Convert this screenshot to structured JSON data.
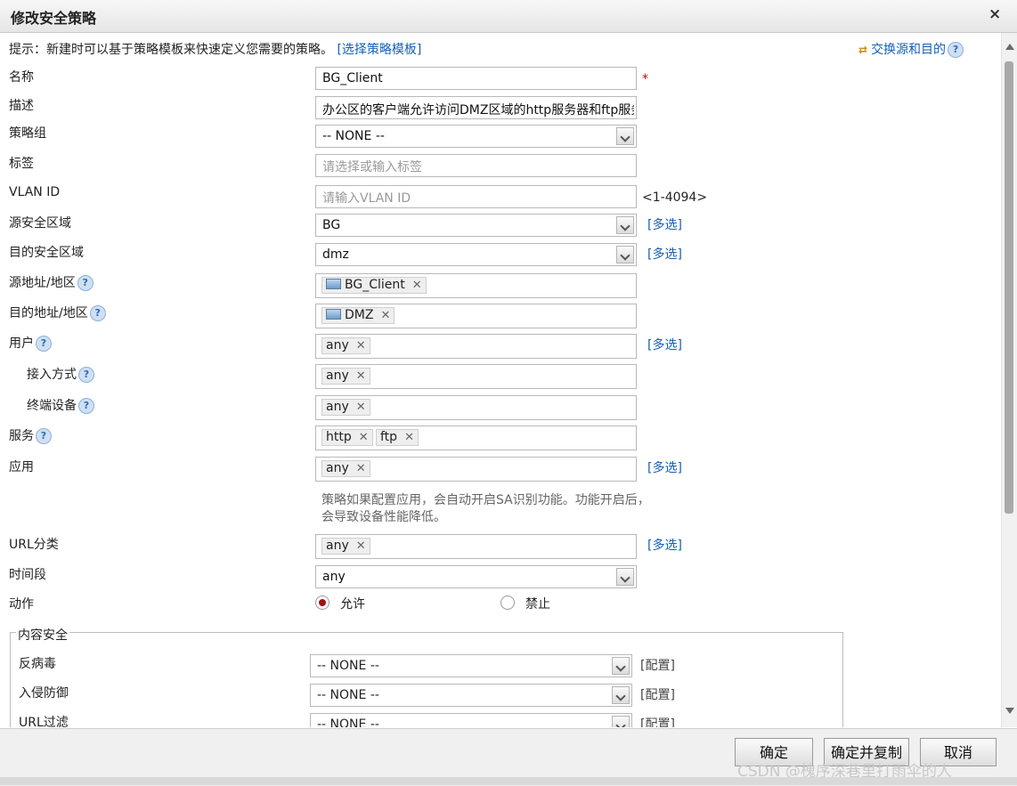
{
  "dialog": {
    "title": "修改安全策略",
    "close": "×"
  },
  "hint": {
    "text": "提示：新建时可以基于策略模板来快速定义您需要的策略。",
    "link": "[选择策略模板]"
  },
  "swap": {
    "icon": "swap-arrows-icon",
    "label": "交换源和目的"
  },
  "help_glyph": "?",
  "fields": {
    "name": {
      "label": "名称",
      "value": "BG_Client",
      "required": "*"
    },
    "desc": {
      "label": "描述",
      "value": "办公区的客户端允许访问DMZ区域的http服务器和ftp服务器"
    },
    "group": {
      "label": "策略组",
      "value": "-- NONE --"
    },
    "tag": {
      "label": "标签",
      "placeholder": "请选择或输入标签"
    },
    "vlan": {
      "label": "VLAN ID",
      "placeholder": "请输入VLAN ID",
      "range": "<1-4094>"
    },
    "src_zone": {
      "label": "源安全区域",
      "value": "BG",
      "multi": "[多选]"
    },
    "dst_zone": {
      "label": "目的安全区域",
      "value": "dmz",
      "multi": "[多选]"
    },
    "src_addr": {
      "label": "源地址/地区",
      "tags": [
        "BG_Client"
      ]
    },
    "dst_addr": {
      "label": "目的地址/地区",
      "tags": [
        "DMZ"
      ]
    },
    "user": {
      "label": "用户",
      "tags": [
        "any"
      ],
      "multi": "[多选]"
    },
    "access": {
      "label": "接入方式",
      "tags": [
        "any"
      ]
    },
    "terminal": {
      "label": "终端设备",
      "tags": [
        "any"
      ]
    },
    "service": {
      "label": "服务",
      "tags": [
        "http",
        "ftp"
      ]
    },
    "app": {
      "label": "应用",
      "tags": [
        "any"
      ],
      "multi": "[多选]",
      "note": "策略如果配置应用，会自动开启SA识别功能。功能开启后，会导致设备性能降低。"
    },
    "url": {
      "label": "URL分类",
      "tags": [
        "any"
      ],
      "multi": "[多选]"
    },
    "time": {
      "label": "时间段",
      "value": "any"
    },
    "action": {
      "label": "动作",
      "allow": "允许",
      "deny": "禁止",
      "selected": "允许"
    }
  },
  "content_security": {
    "legend": "内容安全",
    "rows": [
      {
        "label": "反病毒",
        "value": "-- NONE --",
        "config": "[配置]"
      },
      {
        "label": "入侵防御",
        "value": "-- NONE --",
        "config": "[配置]"
      },
      {
        "label": "URL过滤",
        "value": "-- NONE --",
        "config": "[配置]"
      }
    ]
  },
  "tag_remove": "✕",
  "buttons": {
    "ok": "确定",
    "ok_copy": "确定并复制",
    "cancel": "取消"
  },
  "watermark": "CSDN @槐序深巷里打雨伞的人"
}
